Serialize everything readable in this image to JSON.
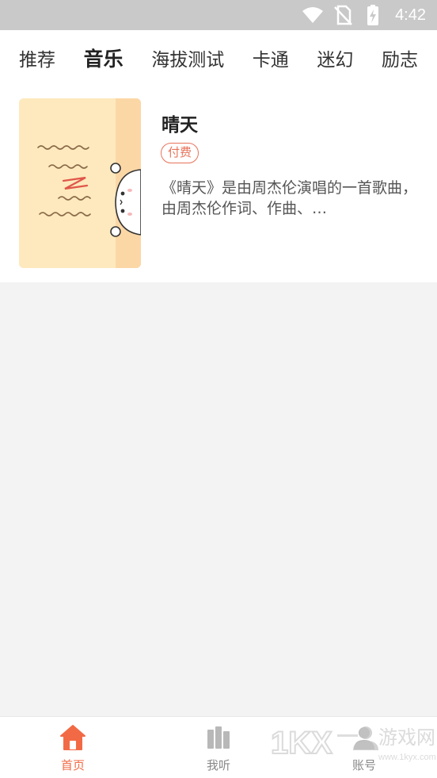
{
  "status_bar": {
    "time": "4:42",
    "icons": [
      "wifi-icon",
      "no-sim-icon",
      "battery-charging-icon"
    ]
  },
  "tabs": [
    {
      "label": "推荐",
      "active": false
    },
    {
      "label": "音乐",
      "active": true
    },
    {
      "label": "海拔测试",
      "active": false
    },
    {
      "label": "卡通",
      "active": false
    },
    {
      "label": "迷幻",
      "active": false
    },
    {
      "label": "励志",
      "active": false
    }
  ],
  "songs": [
    {
      "title": "晴天",
      "badge": "付费",
      "description": "《晴天》是由周杰伦演唱的一首歌曲，由周杰伦作词、作曲、…",
      "thumbnail_icon": "cartoon-note-thumbnail"
    }
  ],
  "bottom_nav": [
    {
      "label": "首页",
      "icon": "home-icon",
      "active": true
    },
    {
      "label": "我听",
      "icon": "library-icon",
      "active": false
    },
    {
      "label": "账号",
      "icon": "account-icon",
      "active": false
    }
  ],
  "watermark": {
    "logo_text": "1KX",
    "brand": "游戏网",
    "url": "www.1kyx.com"
  },
  "colors": {
    "accent": "#f26a45",
    "badge": "#e8735a",
    "status_bar_bg": "#c9c9c9",
    "page_bg": "#f3f3f3"
  }
}
